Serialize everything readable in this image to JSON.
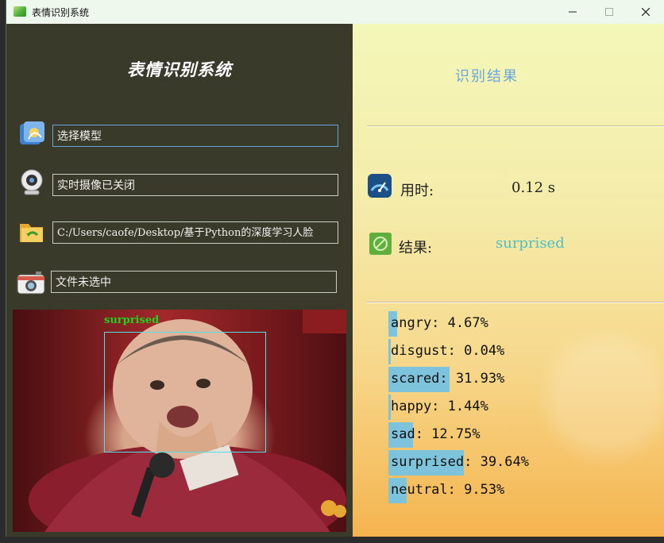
{
  "window": {
    "title": "表情识别系统"
  },
  "left": {
    "app_title": "表情识别系统",
    "model_field": "选择模型",
    "camera_field": "实时摄像已关闭",
    "path_field": "C:/Users/caofe/Desktop/基于Python的深度学习人脸",
    "file_field": "文件未选中",
    "detected_label": "surprised"
  },
  "right": {
    "header": "识别结果",
    "time_label": "用时:",
    "time_value": "0.12 s",
    "result_label": "结果:",
    "result_value": "surprised"
  },
  "colors": {
    "accent": "#6aa7de",
    "result": "#4fbfbf",
    "bar": "#7ec3dc"
  },
  "probabilities": [
    {
      "label": "angry: 4.67%",
      "value": 4.67
    },
    {
      "label": "disgust: 0.04%",
      "value": 0.04
    },
    {
      "label": "scared: 31.93%",
      "value": 31.93
    },
    {
      "label": "happy: 1.44%",
      "value": 1.44
    },
    {
      "label": "sad: 12.75%",
      "value": 12.75
    },
    {
      "label": "surprised: 39.64%",
      "value": 39.64
    },
    {
      "label": "neutral: 9.53%",
      "value": 9.53
    }
  ]
}
